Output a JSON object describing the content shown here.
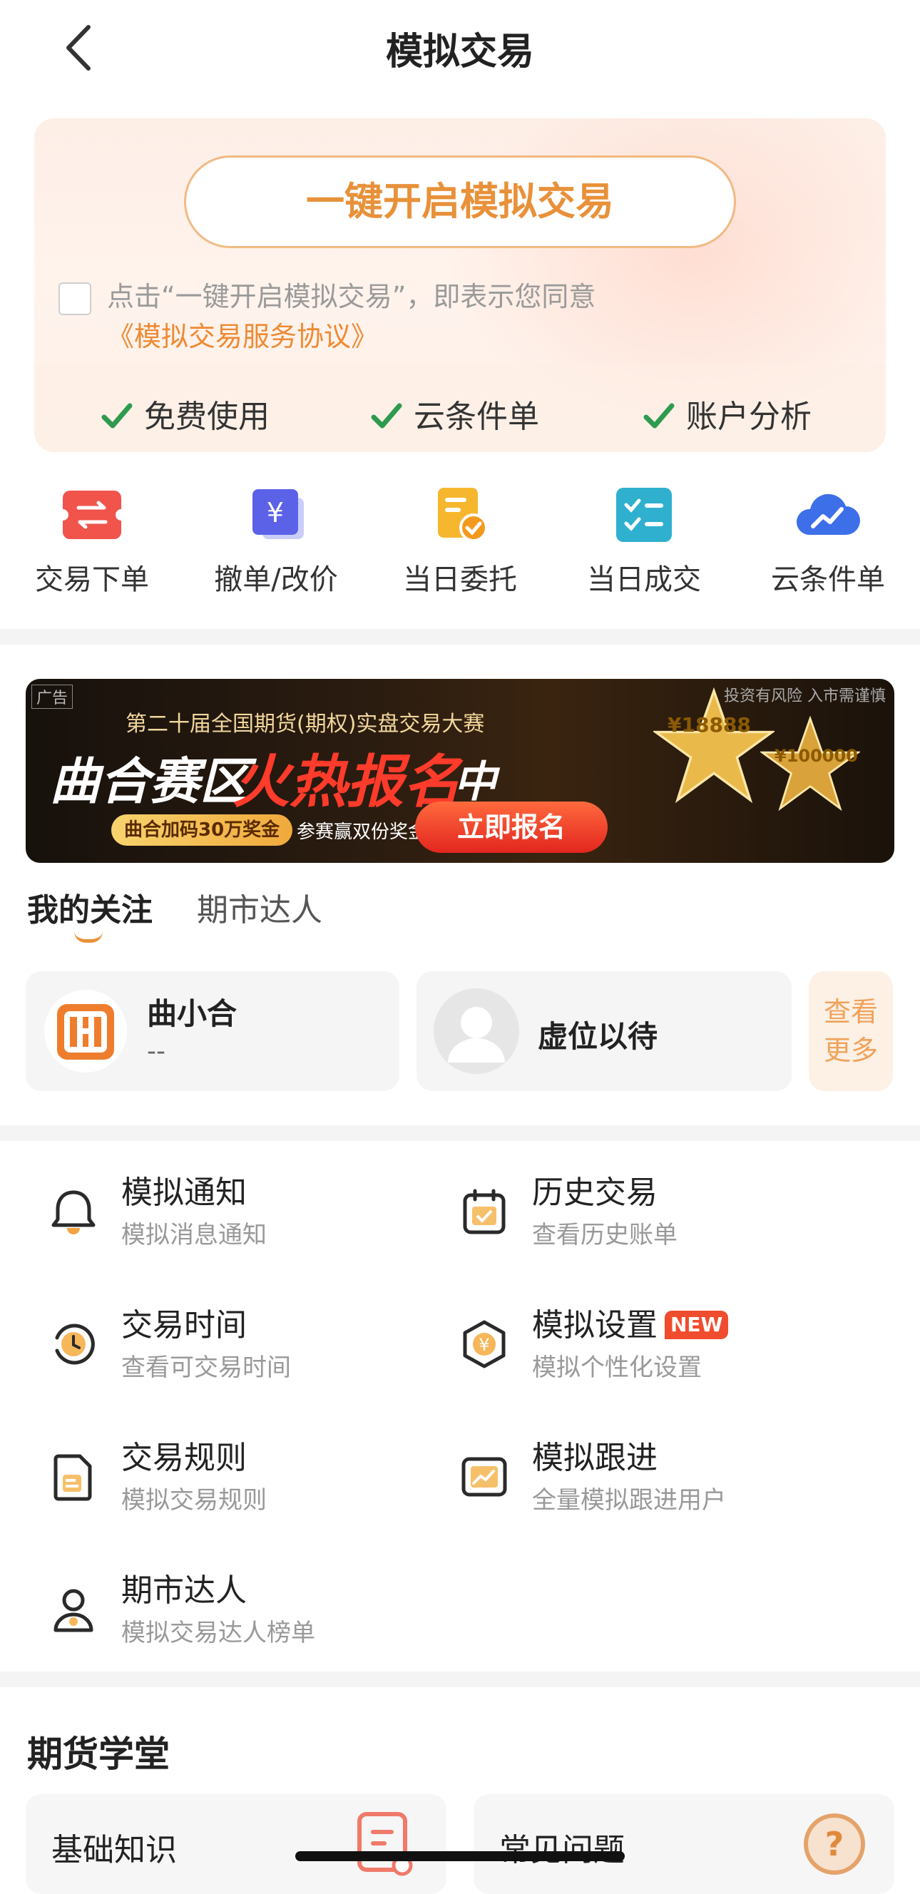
{
  "header": {
    "title": "模拟交易"
  },
  "promo": {
    "open_button": "一键开启模拟交易",
    "agree_prefix": "点击“一键开启模拟交易”，即表示您同意",
    "agree_link": "《模拟交易服务协议》",
    "features": [
      "免费使用",
      "云条件单",
      "账户分析"
    ]
  },
  "quick_actions": [
    {
      "label": "交易下单",
      "icon": "exchange-icon"
    },
    {
      "label": "撤单/改价",
      "icon": "yuan-card-icon"
    },
    {
      "label": "当日委托",
      "icon": "order-check-icon"
    },
    {
      "label": "当日成交",
      "icon": "checklist-icon"
    },
    {
      "label": "云条件单",
      "icon": "cloud-trend-icon"
    }
  ],
  "banner": {
    "ad_tag": "广告",
    "subtitle": "第二十届全国期货(期权)实盘交易大赛",
    "headline_1": "曲合赛区",
    "headline_2": "火热报名",
    "headline_3": "中",
    "pill_1": "曲合加码30万奖金",
    "pill_2": "参赛赢双份奖金",
    "cta": "立即报名",
    "risk": "投资有风险 入市需谨慎",
    "prize_1": "¥18888",
    "prize_2": "¥100000"
  },
  "tabs": [
    {
      "label": "我的关注",
      "active": true
    },
    {
      "label": "期市达人",
      "active": false
    }
  ],
  "follow_cards": [
    {
      "name": "曲小合",
      "value": "--"
    },
    {
      "name": "虚位以待",
      "value": ""
    }
  ],
  "more_button": {
    "line1": "查看",
    "line2": "更多"
  },
  "menu": [
    {
      "title": "模拟通知",
      "subtitle": "模拟消息通知",
      "icon": "bell-icon"
    },
    {
      "title": "历史交易",
      "subtitle": "查看历史账单",
      "icon": "calendar-check-icon"
    },
    {
      "title": "交易时间",
      "subtitle": "查看可交易时间",
      "icon": "clock-icon"
    },
    {
      "title": "模拟设置",
      "subtitle": "模拟个性化设置",
      "icon": "yuan-gear-icon",
      "badge": "NEW"
    },
    {
      "title": "交易规则",
      "subtitle": "模拟交易规则",
      "icon": "document-icon"
    },
    {
      "title": "模拟跟进",
      "subtitle": "全量模拟跟进用户",
      "icon": "trend-box-icon"
    },
    {
      "title": "期市达人",
      "subtitle": "模拟交易达人榜单",
      "icon": "person-icon"
    }
  ],
  "school": {
    "title": "期货学堂",
    "cards": [
      {
        "label": "基础知识",
        "icon": "book-icon"
      },
      {
        "label": "常见问题",
        "icon": "question-icon"
      }
    ]
  },
  "colors": {
    "accent": "#e8913a",
    "check": "#2e9b4f",
    "badge": "#f04c2e"
  }
}
